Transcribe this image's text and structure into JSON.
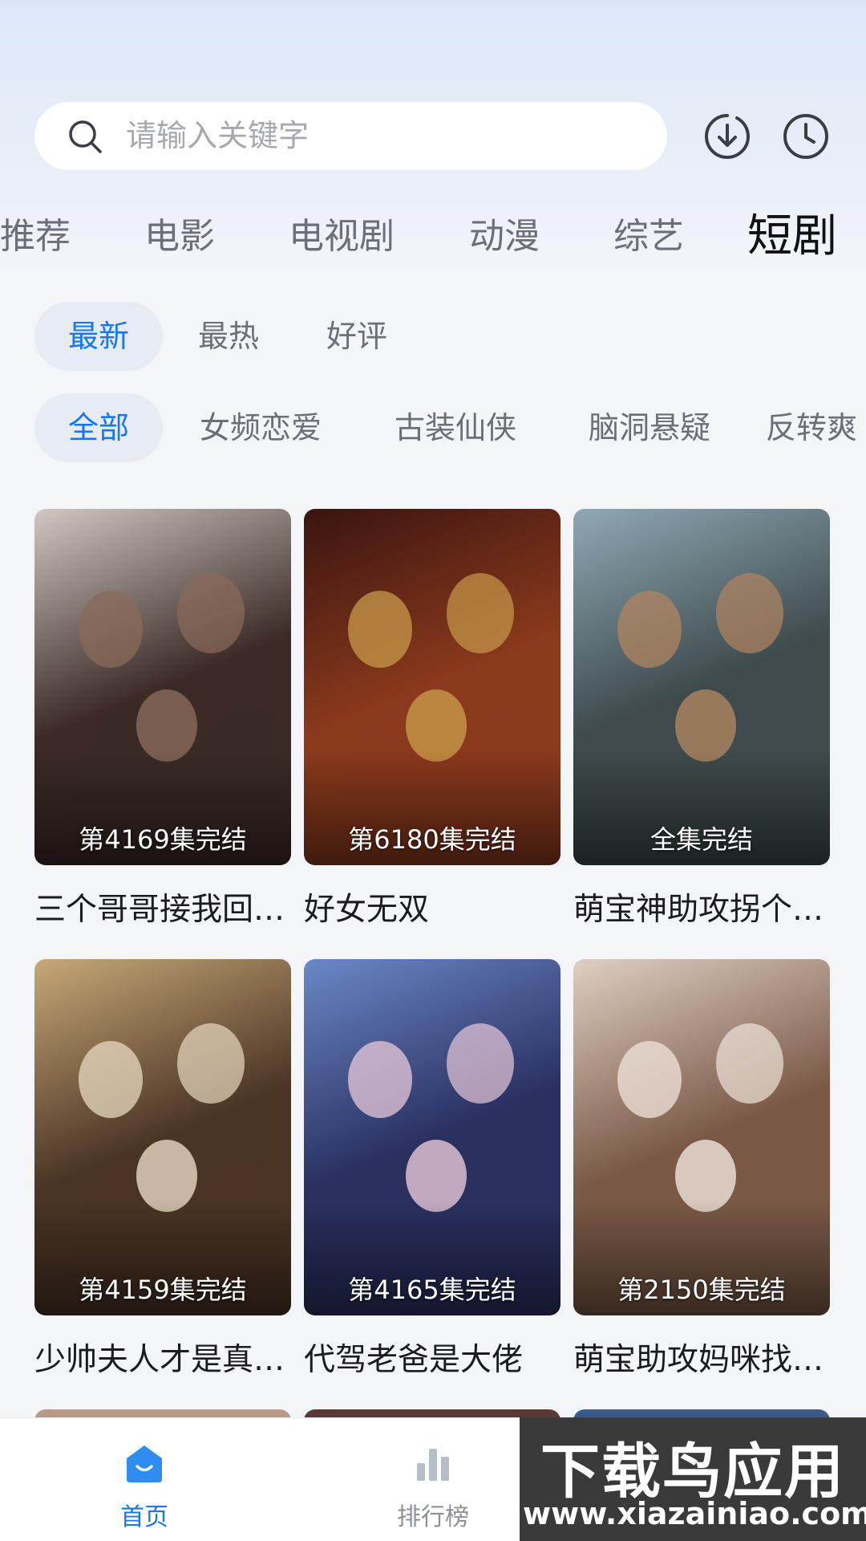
{
  "search": {
    "placeholder": "请输入关键字"
  },
  "top_icons": {
    "download": "download-icon",
    "history": "history-clock-icon"
  },
  "category_tabs": [
    {
      "label": "推荐",
      "active": false
    },
    {
      "label": "电影",
      "active": false
    },
    {
      "label": "电视剧",
      "active": false
    },
    {
      "label": "动漫",
      "active": false
    },
    {
      "label": "综艺",
      "active": false
    },
    {
      "label": "短剧",
      "active": true
    }
  ],
  "sort_options": [
    {
      "label": "最新",
      "active": true
    },
    {
      "label": "最热",
      "active": false
    },
    {
      "label": "好评",
      "active": false
    }
  ],
  "genres": [
    {
      "label": "全部",
      "active": true
    },
    {
      "label": "女频恋爱",
      "active": false
    },
    {
      "label": "古装仙侠",
      "active": false
    },
    {
      "label": "脑洞悬疑",
      "active": false
    },
    {
      "label": "反转爽",
      "active": false
    }
  ],
  "dramas": [
    {
      "title": "三个哥哥接我回…",
      "badge": "第4169集完结",
      "colors": [
        "#cfc8c2",
        "#3b2a26",
        "#8a6b5a"
      ]
    },
    {
      "title": "好女无双",
      "badge": "第6180集完结",
      "colors": [
        "#3a1410",
        "#8b3a1c",
        "#c89a4a"
      ]
    },
    {
      "title": "萌宝神助攻拐个…",
      "badge": "全集完结",
      "colors": [
        "#8fa9b5",
        "#3e4a4c",
        "#b08460"
      ]
    },
    {
      "title": "少帅夫人才是真…",
      "badge": "第4159集完结",
      "colors": [
        "#c8a878",
        "#4a3424",
        "#e8d8c0"
      ]
    },
    {
      "title": "代驾老爸是大佬",
      "badge": "第4165集完结",
      "colors": [
        "#6a88c8",
        "#2a3060",
        "#e8c8d8"
      ]
    },
    {
      "title": "萌宝助攻妈咪找…",
      "badge": "第2150集完结",
      "colors": [
        "#e0cfc4",
        "#7a5a46",
        "#f0e4dc"
      ]
    }
  ],
  "bottom_nav": [
    {
      "label": "首页",
      "active": true
    },
    {
      "label": "排行榜",
      "active": false
    }
  ],
  "watermark": {
    "title": "下载鸟应用",
    "url": "www.xiazainiao.com"
  },
  "colors": {
    "accent": "#1677f0",
    "tab_inactive": "#6b6f78",
    "pill_bg": "#e7ebf2"
  }
}
